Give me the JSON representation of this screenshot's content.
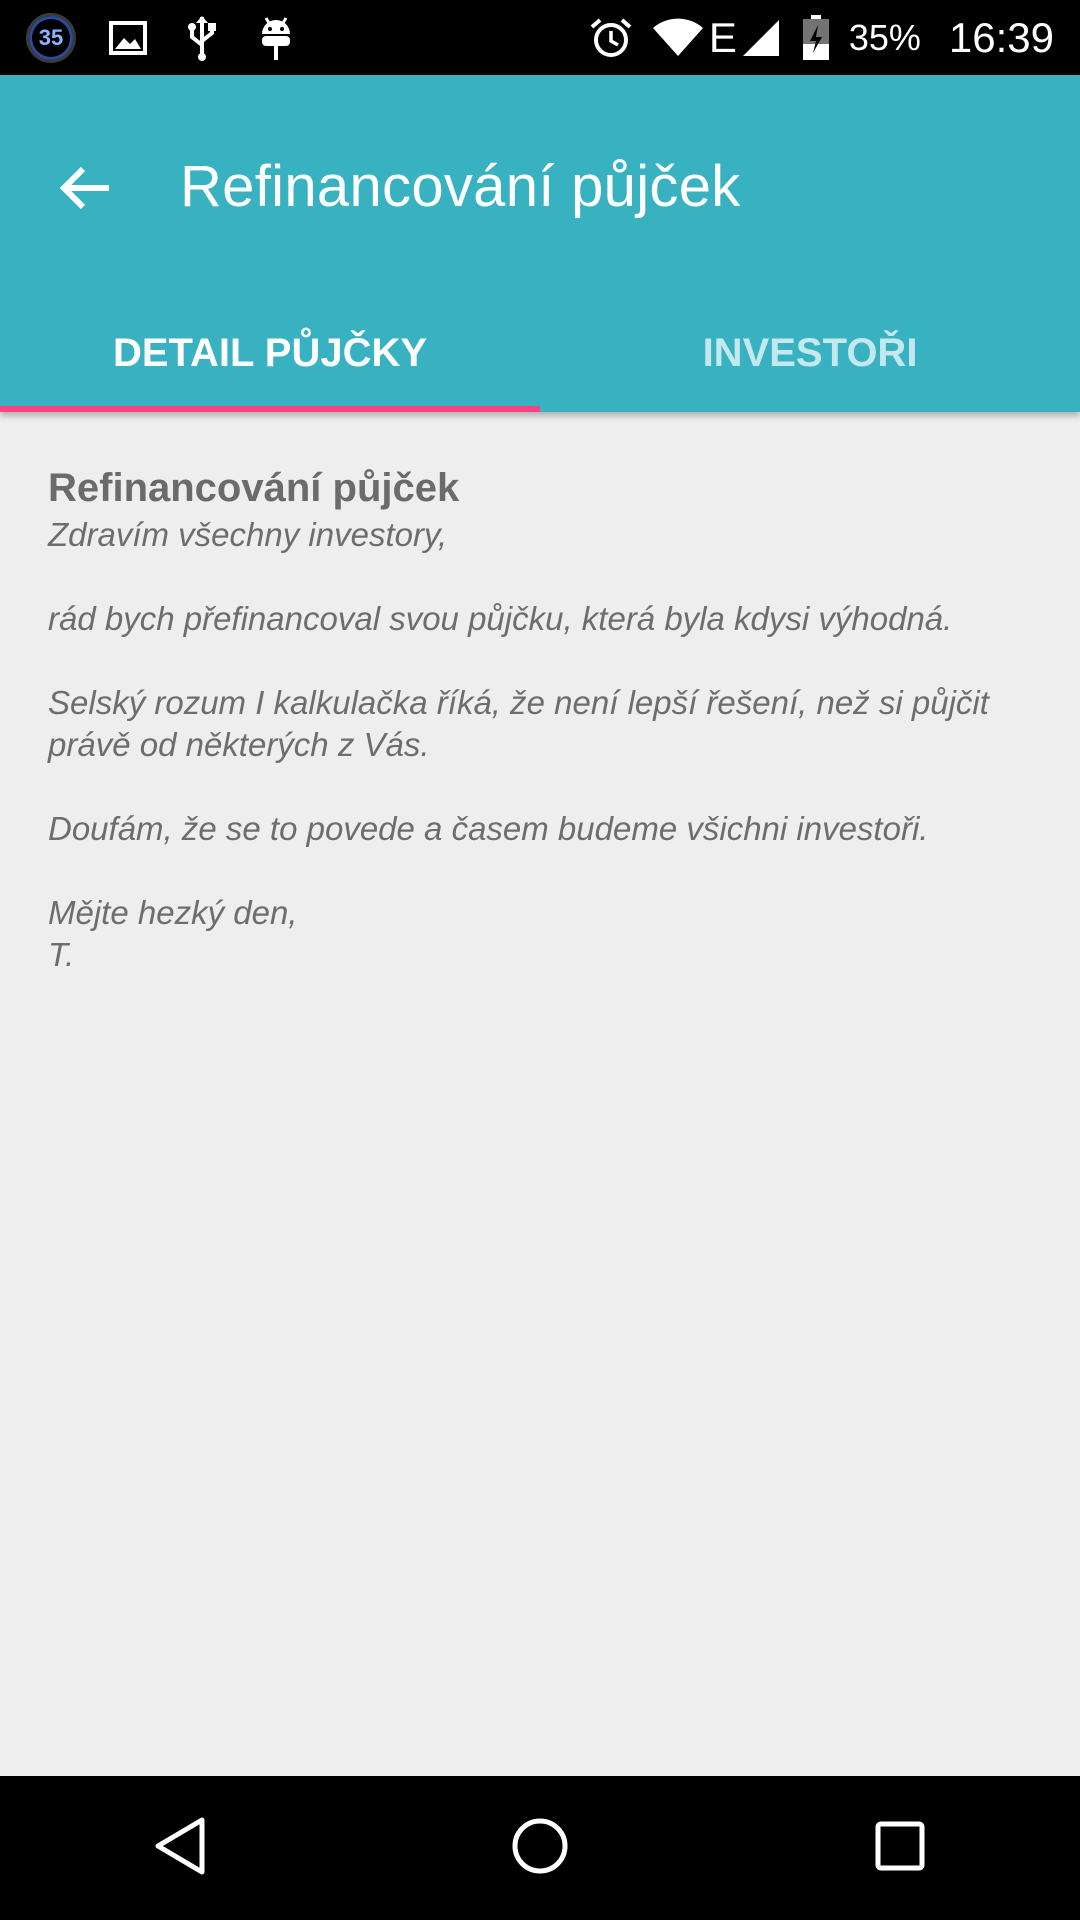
{
  "status_bar": {
    "notification_count": "35",
    "battery_percent": "35%",
    "time": "16:39",
    "network_type": "E",
    "icons": [
      "notification-counter-icon",
      "image-icon",
      "usb-icon",
      "android-debug-icon",
      "alarm-icon",
      "wifi-icon",
      "signal-icon",
      "battery-charging-icon"
    ]
  },
  "app_bar": {
    "title": "Refinancování půjček",
    "back_icon": "arrow-back-icon",
    "background_color": "#38b2c1"
  },
  "tabs": [
    {
      "label": "DETAIL PŮJČKY",
      "active": true
    },
    {
      "label": "INVESTOŘI",
      "active": false
    }
  ],
  "tab_indicator_color": "#ff4081",
  "detail": {
    "title": "Refinancování půjček",
    "paragraphs": [
      "Zdravím všechny investory,",
      "rád bych přefinancoval svou půjčku, která byla kdysi výhodná.",
      "Selský rozum I kalkulačka říká, že není lepší řešení, než si půjčit právě od některých z Vás.",
      "Doufám, že se to povede a časem budeme všichni investoři.",
      "Mějte hezký den,\nT."
    ]
  },
  "nav_bar": {
    "icons": [
      "back-triangle-icon",
      "home-circle-icon",
      "recents-square-icon"
    ]
  }
}
